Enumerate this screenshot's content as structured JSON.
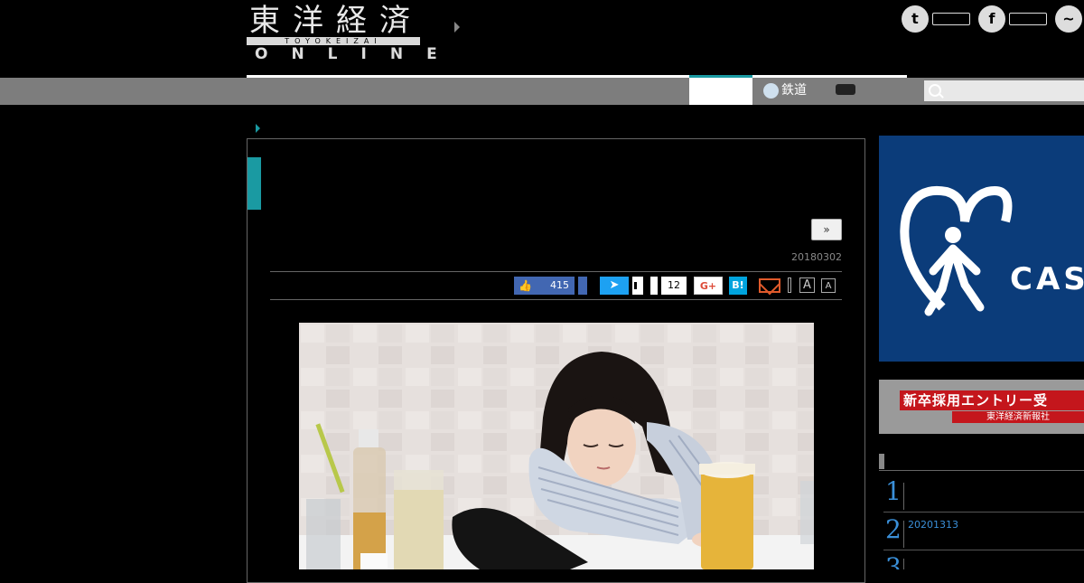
{
  "header": {
    "logo_main": "東洋経済",
    "logo_romaji": "TOYOKEIZAI",
    "logo_sub": "ONLINE"
  },
  "social_top": {
    "twitter_icon": "twitter-icon",
    "facebook_icon": "facebook-icon",
    "messenger_icon": "messenger-icon"
  },
  "nav": {
    "rail_label": "鉄道",
    "search_placeholder": ""
  },
  "article": {
    "next_label": "»",
    "date": "20180302",
    "share": {
      "like_count": "415",
      "pocket_count": "12",
      "gplus_label": "G+",
      "hatena_label": "B!",
      "font_large_label": "A",
      "font_small_label": "A"
    }
  },
  "sidebar": {
    "ad_brand": "CAS",
    "recruit_banner": "新卒採用エントリー受",
    "recruit_sub": "東洋経済新報社",
    "ranking": [
      {
        "rank": "1",
        "title": ""
      },
      {
        "rank": "2",
        "title": "20201313"
      },
      {
        "rank": "3",
        "title": ""
      }
    ]
  },
  "colors": {
    "accent_teal": "#1a9aa2",
    "nav_gray": "#7d7d7d",
    "ad_blue": "#0b3c7a",
    "recruit_red": "#c4161c",
    "rank_blue": "#3a8fd8"
  }
}
